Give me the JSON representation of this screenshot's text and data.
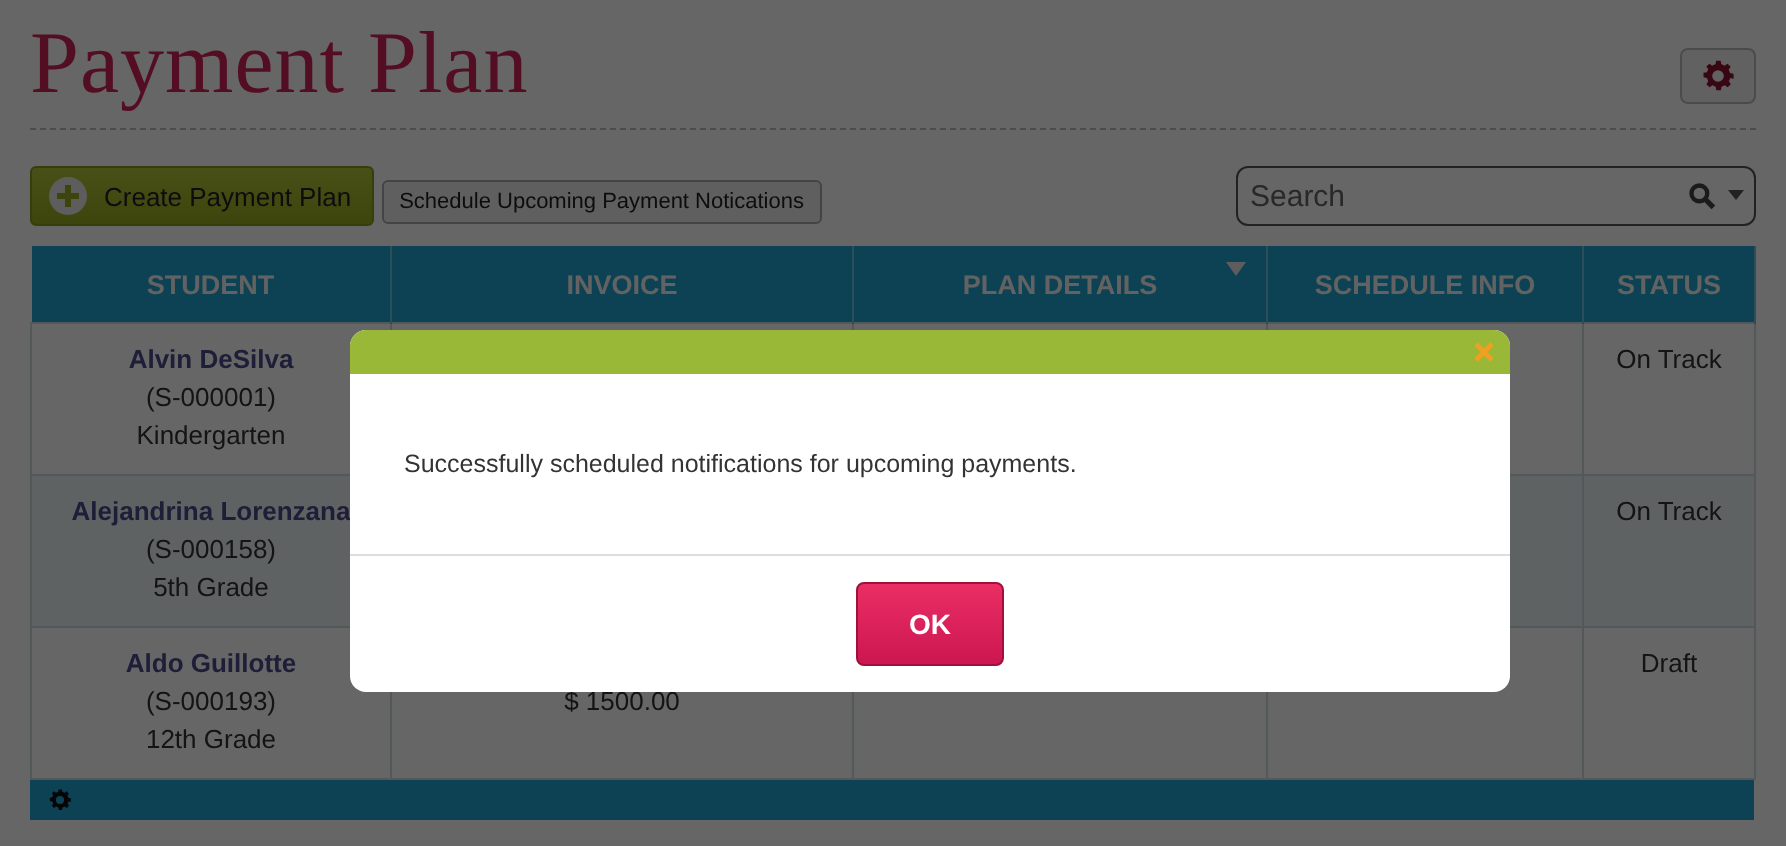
{
  "page": {
    "title": "Payment Plan"
  },
  "toolbar": {
    "create_button": "Create Payment Plan",
    "schedule_button": "Schedule Upcoming Payment Notications",
    "search": {
      "placeholder": "Search"
    }
  },
  "table": {
    "columns": [
      {
        "label": "STUDENT",
        "menu": false
      },
      {
        "label": "INVOICE",
        "menu": false
      },
      {
        "label": "PLAN DETAILS",
        "menu": true
      },
      {
        "label": "SCHEDULE INFO",
        "menu": false
      },
      {
        "label": "STATUS",
        "menu": false
      }
    ],
    "rows": [
      {
        "name": "Alvin DeSilva",
        "id": "(S-000001)",
        "grade": "Kindergarten",
        "status": "On Track"
      },
      {
        "name": "Alejandrina Lorenzana",
        "id": "(S-000158)",
        "grade": "5th Grade",
        "status": "On Track"
      },
      {
        "name": "Aldo Guillotte",
        "id": "(S-000193)",
        "grade": "12th Grade",
        "invoice": "$ 1500.00",
        "status": "Draft"
      }
    ]
  },
  "dialog": {
    "message": "Successfully scheduled notifications for upcoming payments.",
    "ok_button": "OK"
  }
}
